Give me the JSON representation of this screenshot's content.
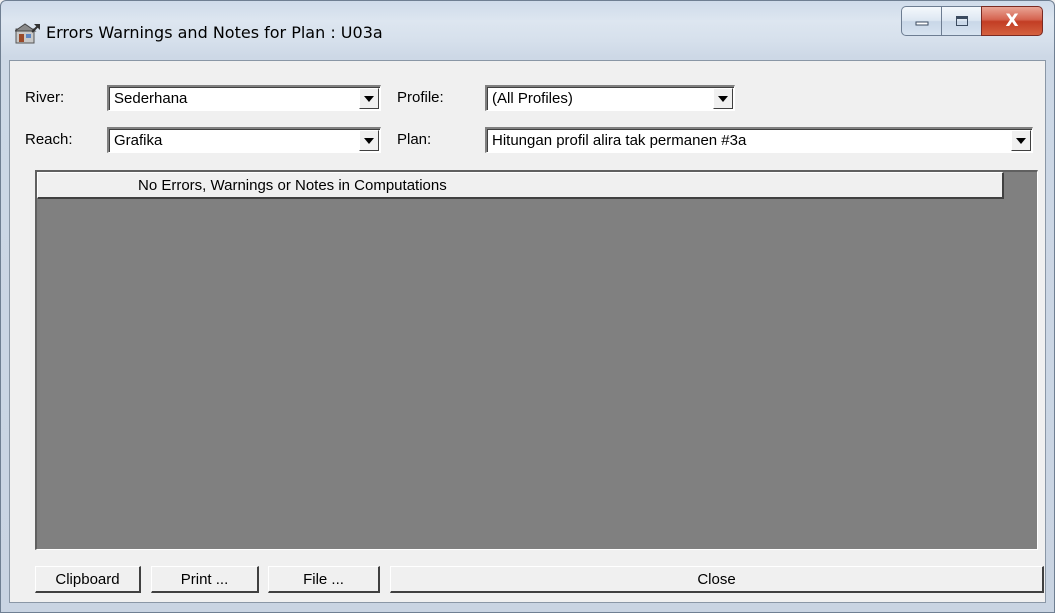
{
  "window": {
    "title": "Errors Warnings and Notes for Plan : U03a",
    "icon": "hec-ras-app-icon",
    "controls": {
      "minimize": "minimize-icon",
      "maximize": "maximize-icon",
      "close_glyph": "X"
    }
  },
  "filters": {
    "river": {
      "label": "River:",
      "value": "Sederhana"
    },
    "reach": {
      "label": "Reach:",
      "value": "Grafika"
    },
    "profile": {
      "label": "Profile:",
      "value": "(All Profiles)"
    },
    "plan": {
      "label": "Plan:",
      "value": "Hitungan profil alira tak permanen #3a"
    }
  },
  "results": {
    "header": "No Errors, Warnings or Notes in Computations",
    "background_color": "#808080"
  },
  "buttons": {
    "clipboard": "Clipboard",
    "print": "Print ...",
    "file": "File ...",
    "close": "Close"
  }
}
